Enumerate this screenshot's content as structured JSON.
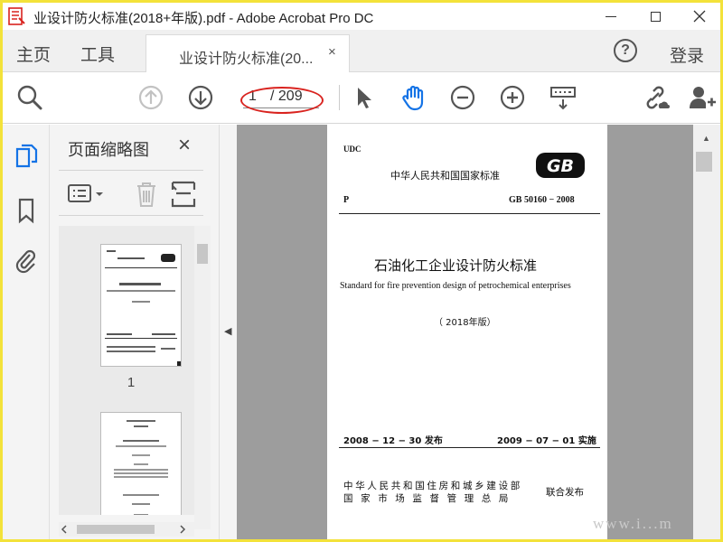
{
  "window": {
    "title": "业设计防火标准(2018+年版).pdf - Adobe Acrobat Pro DC"
  },
  "tabs": {
    "home": "主页",
    "tools": "工具",
    "doc_tab_label": "业设计防火标准(20...",
    "doc_tab_close": "×",
    "help": "?",
    "login": "登录"
  },
  "toolbar": {
    "current_page": "1",
    "total_pages": "/ 209",
    "icons": [
      "search-icon",
      "previous-page-icon",
      "next-page-icon",
      "select-cursor-icon",
      "hand-tool-icon",
      "zoom-out-icon",
      "zoom-in-icon",
      "keyboard-scroll-icon",
      "share-link-icon",
      "add-user-icon"
    ]
  },
  "side_rail": {
    "icons": [
      "page-thumbnails-icon",
      "bookmarks-icon",
      "attachments-icon"
    ]
  },
  "thumbnails_panel": {
    "title": "页面缩略图",
    "close": "×",
    "thumbnail_labels": [
      "1"
    ]
  },
  "document_page": {
    "udc": "UDC",
    "national_standard": "中华人民共和国国家标准",
    "gb_logo": "GB",
    "class_letter": "P",
    "code": "GB 50160 − 2008",
    "title_cn": "石油化工企业设计防火标准",
    "title_en": "Standard for fire prevention design of petrochemical enterprises",
    "edition": "（ 2018年版）",
    "issue_date": "2008 − 12 − 30  发布",
    "effective_date": "2009 − 07 − 01  实施",
    "issuer_1": "中华人民共和国住房和城乡建设部",
    "issuer_2": "国家市场监督管理总局",
    "joint_issue": "联合发布"
  },
  "watermark": "www.i...m",
  "colors": {
    "window_border": "#f3e23a",
    "annotation_oval": "#d9231f",
    "icon_blue": "#1473e6",
    "doc_background": "#9d9d9d"
  }
}
